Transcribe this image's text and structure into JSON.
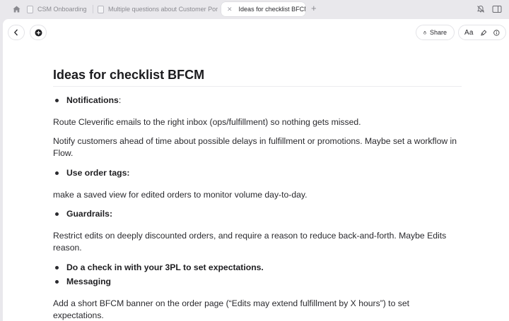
{
  "tabs": [
    {
      "label": "CSM Onboarding",
      "active": false
    },
    {
      "label": "Multiple questions about Customer Portal",
      "active": false
    },
    {
      "label": "Ideas for checklist BFCM",
      "active": true
    }
  ],
  "toolbar": {
    "share_label": "Share",
    "font_label": "Aa"
  },
  "document": {
    "title": "Ideas for checklist BFCM",
    "blocks": [
      {
        "type": "bullet",
        "text": "Notifications",
        "suffix": ":"
      },
      {
        "type": "paragraph",
        "text": "Route Cleverific emails to the right inbox (ops/fulfillment) so nothing gets missed."
      },
      {
        "type": "paragraph",
        "text": "Notify customers ahead of time about possible delays in fulfillment or promotions. Maybe set a workflow in Flow."
      },
      {
        "type": "bullet",
        "text": "Use order tags:",
        "suffix": ""
      },
      {
        "type": "paragraph",
        "text": "make a saved view for edited orders to monitor volume day-to-day."
      },
      {
        "type": "bullet",
        "text": "Guardrails:",
        "suffix": ""
      },
      {
        "type": "paragraph",
        "text": "Restrict edits on deeply discounted orders, and require a reason to reduce back-and-forth. Maybe Edits reason."
      },
      {
        "type": "bullet",
        "text": "Do a check in with your 3PL to set expectations.",
        "suffix": ""
      },
      {
        "type": "bullet",
        "text": "Messaging",
        "suffix": ""
      },
      {
        "type": "paragraph",
        "text": "Add a short BFCM banner on the order page (“Edits may extend fulfillment by X hours”) to set expectations."
      }
    ]
  }
}
